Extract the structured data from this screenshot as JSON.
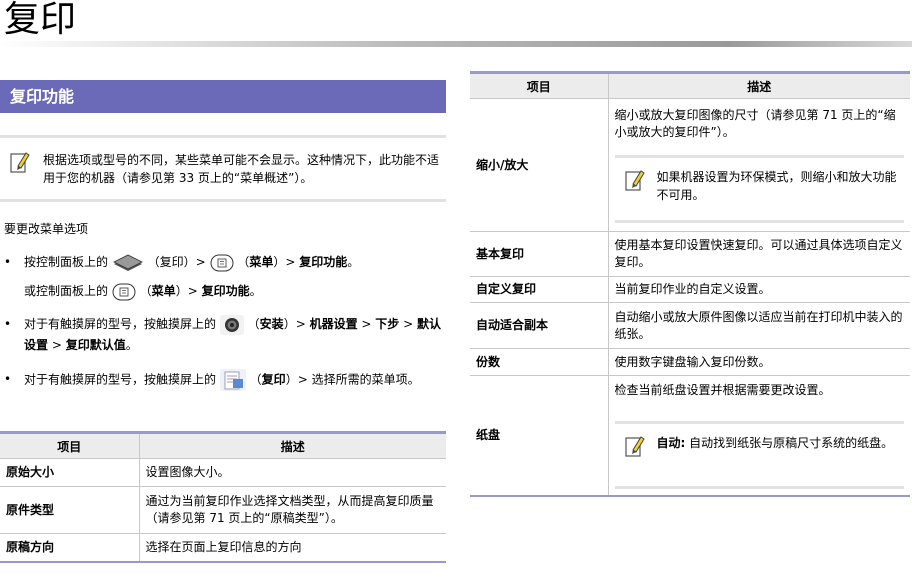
{
  "page": {
    "title": "复印"
  },
  "section": {
    "title": "复印功能"
  },
  "note_top": "根据选项或型号的不同，某些菜单可能不会显示。这种情况下，此功能不适用于您的机器（请参见第 33 页上的“菜单概述”）。",
  "lead": "要更改菜单选项",
  "bullets": [
    {
      "pre": "按控制面板上的 ",
      "mid1": "（复印）> ",
      "mid2": "（",
      "menu": "菜单",
      "post": "）> ",
      "end": "复印功能",
      "tail": "。"
    },
    {
      "pre": "或控制面板上的 ",
      "mid2": "（",
      "menu": "菜单",
      "post": "）> ",
      "end": "复印功能",
      "tail": "。"
    },
    {
      "pre": "对于有触摸屏的型号，按触摸屏上的 ",
      "paren": "（",
      "label": "安装",
      "p2": "）> ",
      "a": "机器设置",
      "sep": " > ",
      "b": "下步",
      "sep2": " > ",
      "c": "默认设置",
      "sep3": " > ",
      "d": "复印默认值",
      "tail": "。"
    },
    {
      "pre": "对于有触摸屏的型号，按触摸屏上的 ",
      "paren": "（",
      "label": "复印",
      "p2": "）> ",
      "rest": "选择所需的菜单项。"
    }
  ],
  "bullet_dot": "•",
  "left_table": {
    "headers": [
      "项目",
      "描述"
    ],
    "rows": [
      {
        "key": "原始大小",
        "value": "设置图像大小。"
      },
      {
        "key": "原件类型",
        "value": "通过为当前复印作业选择文档类型，从而提高复印质量（请参见第 71 页上的“原稿类型”）。"
      },
      {
        "key": "原稿方向",
        "value": "选择在页面上复印信息的方向"
      }
    ]
  },
  "right_table": {
    "headers": [
      "项目",
      "描述"
    ],
    "rows": [
      {
        "key": "缩小/放大",
        "value": "缩小或放大复印图像的尺寸（请参见第 71 页上的“缩小或放大的复印件”）。",
        "note": "如果机器设置为环保模式，则缩小和放大功能不可用。"
      },
      {
        "key": "基本复印",
        "value": "使用基本复印设置快速复印。可以通过具体选项自定义复印。"
      },
      {
        "key": "自定义复印",
        "value": "当前复印作业的自定义设置。"
      },
      {
        "key": "自动适合副本",
        "value": "自动缩小或放大原件图像以适应当前在打印机中装入的纸张。"
      },
      {
        "key": "份数",
        "value": "使用数字键盘输入复印份数。"
      },
      {
        "key": "纸盘",
        "value": "检查当前纸盘设置并根据需要更改设置。",
        "note_bold": "自动:",
        "note": " 自动找到纸张与原稿尺寸系统的纸盘。"
      }
    ]
  },
  "icons": {
    "note": "note-pencil-icon",
    "copy": "copy-icon",
    "menu": "menu-button-icon",
    "setup": "setup-gear-icon",
    "copy_screen": "copy-screen-icon"
  },
  "colors": {
    "section_header": "#6a6ab8",
    "table_rule": "#9a9ac8",
    "header_bg": "#ececec"
  }
}
